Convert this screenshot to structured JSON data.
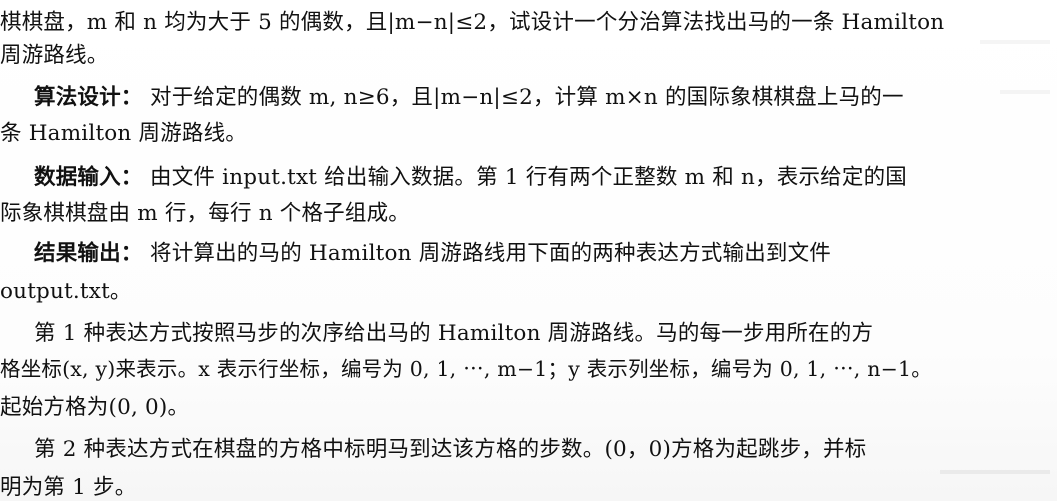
{
  "lines": [
    "棋棋盘，m 和 n 均为大于 5 的偶数，且|m−n|≤2，试设计一个分治算法找出马的一条 Hamilton",
    "周游路线。",
    "算法设计：",
    "对于给定的偶数 m, n≥6，且|m−n|≤2，计算 m×n 的国际象棋棋盘上马的一",
    "条 Hamilton 周游路线。",
    "数据输入：",
    "由文件 input.txt 给出输入数据。第 1 行有两个正整数 m 和 n，表示给定的国",
    "际象棋棋盘由 m 行，每行 n 个格子组成。",
    "结果输出：",
    "将计算出的马的 Hamilton 周游路线用下面的两种表达方式输出到文件",
    "output.txt。",
    "第 1 种表达方式按照马步的次序给出马的 Hamilton 周游路线。马的每一步用所在的方",
    "格坐标(x, y)来表示。x 表示行坐标，编号为 0, 1, ⋯, m−1；y 表示列坐标，编号为 0, 1, ⋯, n−1。",
    "起始方格为(0, 0)。",
    "第 2 种表达方式在棋盘的方格中标明马到达该方格的步数。(0，0)方格为起跳步，并标",
    "明为第 1 步。"
  ]
}
